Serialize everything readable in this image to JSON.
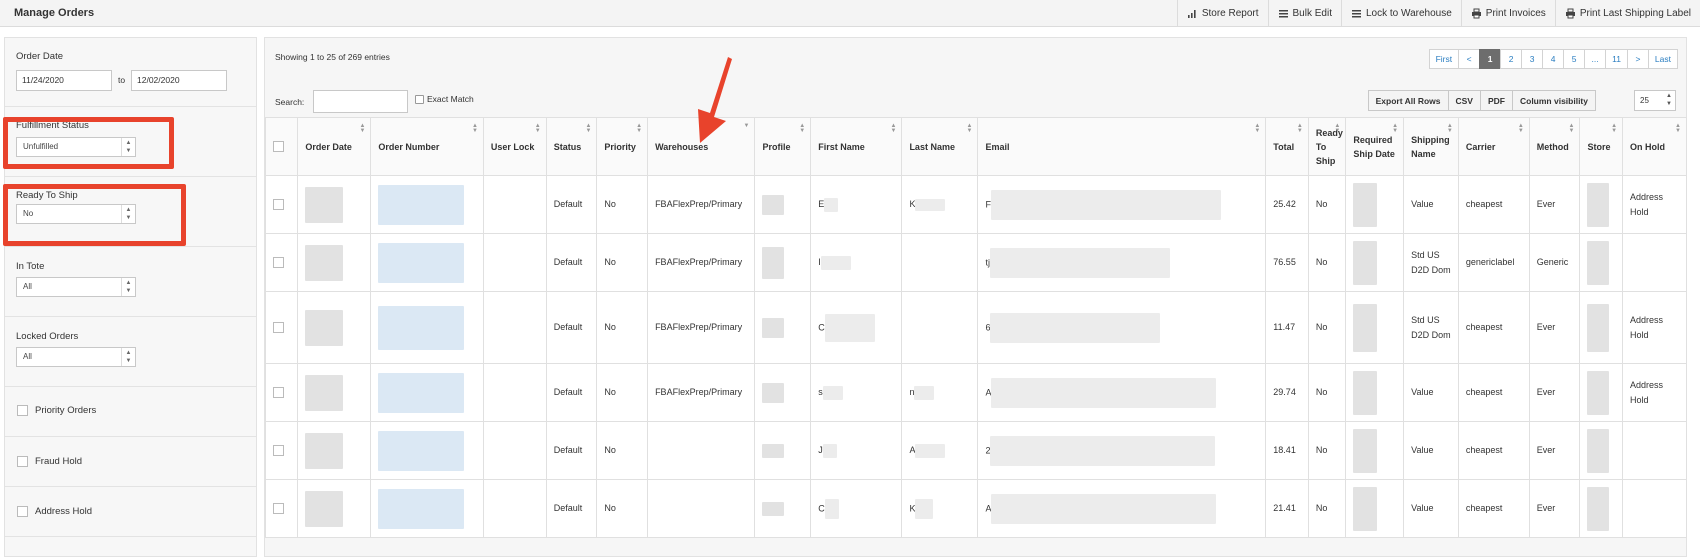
{
  "header": {
    "title": "Manage Orders",
    "actions": [
      {
        "icon": "bar-chart-icon",
        "label": "Store Report"
      },
      {
        "icon": "list-icon",
        "label": "Bulk Edit"
      },
      {
        "icon": "list-icon",
        "label": "Lock to Warehouse"
      },
      {
        "icon": "printer-icon",
        "label": "Print Invoices"
      },
      {
        "icon": "printer-icon",
        "label": "Print Last Shipping Label"
      }
    ]
  },
  "filters": {
    "order_date": {
      "label": "Order Date",
      "from": "11/24/2020",
      "to_label": "to",
      "to": "12/02/2020"
    },
    "fulfillment_status": {
      "label": "Fulfillment Status",
      "value": "Unfulfilled"
    },
    "ready_to_ship": {
      "label": "Ready To Ship",
      "value": "No"
    },
    "in_tote": {
      "label": "In Tote",
      "value": "All"
    },
    "locked_orders": {
      "label": "Locked Orders",
      "value": "All"
    },
    "priority_orders": {
      "label": "Priority Orders"
    },
    "fraud_hold": {
      "label": "Fraud Hold"
    },
    "address_hold": {
      "label": "Address Hold"
    }
  },
  "table_controls": {
    "showing": "Showing 1 to 25 of 269 entries",
    "pages": [
      "First",
      "<",
      "1",
      "2",
      "3",
      "4",
      "5",
      "...",
      "11",
      ">",
      "Last"
    ],
    "active_page": "1",
    "search_label": "Search:",
    "exact_match": "Exact Match",
    "export_buttons": [
      "Export All Rows",
      "CSV",
      "PDF",
      "Column visibility"
    ],
    "page_length": "25"
  },
  "columns": [
    "Order Date",
    "Order Number",
    "User Lock",
    "Status",
    "Priority",
    "Warehouses",
    "Profile",
    "First Name",
    "Last Name",
    "Email",
    "Total",
    "Ready To Ship",
    "Required Ship Date",
    "Shipping Name",
    "Carrier",
    "Method",
    "Store",
    "On Hold"
  ],
  "rows": [
    {
      "status": "Default",
      "priority": "No",
      "warehouse": "FBAFlexPrep/Primary",
      "first": "E",
      "last": "K",
      "email": "F",
      "total": "25.42",
      "ready": "No",
      "shipping": "Value",
      "carrier": "cheapest",
      "method": "Ever",
      "on_hold": "Address Hold"
    },
    {
      "status": "Default",
      "priority": "No",
      "warehouse": "FBAFlexPrep/Primary",
      "first": "I",
      "last": "",
      "email": "tj",
      "total": "76.55",
      "ready": "No",
      "shipping": "Std US D2D Dom",
      "carrier": "genericlabel",
      "method": "Generic",
      "on_hold": ""
    },
    {
      "status": "Default",
      "priority": "No",
      "warehouse": "FBAFlexPrep/Primary",
      "first": "C",
      "last": "",
      "email": "6",
      "total": "11.47",
      "ready": "No",
      "shipping": "Std US D2D Dom",
      "carrier": "cheapest",
      "method": "Ever",
      "on_hold": "Address Hold"
    },
    {
      "status": "Default",
      "priority": "No",
      "warehouse": "FBAFlexPrep/Primary",
      "first": "s",
      "last": "n",
      "email": "A",
      "total": "29.74",
      "ready": "No",
      "shipping": "Value",
      "carrier": "cheapest",
      "method": "Ever",
      "on_hold": "Address Hold"
    },
    {
      "status": "Default",
      "priority": "No",
      "warehouse": "",
      "first": "J",
      "last": "A",
      "email": "2",
      "total": "18.41",
      "ready": "No",
      "shipping": "Value",
      "carrier": "cheapest",
      "method": "Ever",
      "on_hold": ""
    },
    {
      "status": "Default",
      "priority": "No",
      "warehouse": "",
      "first": "C",
      "last": "K",
      "email": "A",
      "total": "21.41",
      "ready": "No",
      "shipping": "Value",
      "carrier": "cheapest",
      "method": "Ever",
      "on_hold": ""
    }
  ],
  "annotation_color": "#e8432c"
}
